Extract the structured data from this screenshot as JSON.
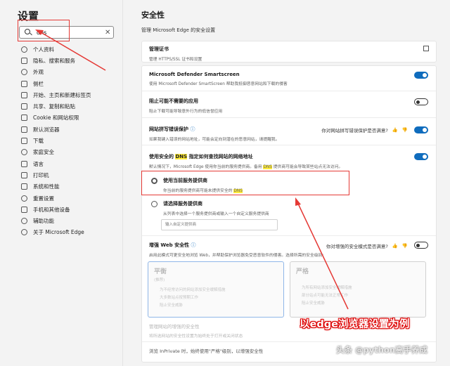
{
  "sidebar": {
    "title": "设置",
    "search_value": "dns",
    "items": [
      {
        "label": "个人资料",
        "icon": "person-icon"
      },
      {
        "label": "隐私、搜索和服务",
        "icon": "lock-icon"
      },
      {
        "label": "外观",
        "icon": "palette-icon"
      },
      {
        "label": "侧栏",
        "icon": "sidebar-icon"
      },
      {
        "label": "开始、主页和新建标签页",
        "icon": "home-icon"
      },
      {
        "label": "共享、复制和粘贴",
        "icon": "share-icon"
      },
      {
        "label": "Cookie 和网站权限",
        "icon": "cookie-icon"
      },
      {
        "label": "默认浏览器",
        "icon": "browser-icon"
      },
      {
        "label": "下载",
        "icon": "download-icon"
      },
      {
        "label": "家庭安全",
        "icon": "family-icon"
      },
      {
        "label": "语言",
        "icon": "language-icon"
      },
      {
        "label": "打印机",
        "icon": "printer-icon"
      },
      {
        "label": "系统和性能",
        "icon": "system-icon"
      },
      {
        "label": "重置设置",
        "icon": "reset-icon"
      },
      {
        "label": "手机和其他设备",
        "icon": "phone-icon"
      },
      {
        "label": "辅助功能",
        "icon": "accessibility-icon"
      },
      {
        "label": "关于 Microsoft Edge",
        "icon": "edge-icon"
      }
    ]
  },
  "main": {
    "title": "安全性",
    "subtitle": "管理 Microsoft Edge 的安全设置",
    "cert": {
      "title": "管理证书",
      "desc": "管理 HTTPS/SSL 证书和设置"
    },
    "smartscreen": {
      "title": "Microsoft Defender Smartscreen",
      "desc": "使用 Microsoft Defender SmartScreen 帮助我抵御恶意网站和下载的侵害",
      "state": "on"
    },
    "pua": {
      "title": "阻止可能不需要的应用",
      "desc": "阻止下载可能导致意外行为的低信誉应用",
      "state": "off"
    },
    "typo": {
      "title": "网站拼写错误保护",
      "desc1": "如果我键入错误的网站地址，可能会定向到潜在的恶意网站，请提醒我。",
      "feedback": "你对网站拼写错误保护是否满意?",
      "state": "on"
    },
    "dns": {
      "title_pre": "使用安全的 ",
      "title_hl": "DNS",
      "title_post": " 指定如何查找网站的网络地址",
      "desc_pre": "默认情况下，Microsoft Edge 使用你当前的服务提供商。备用 ",
      "desc_hl": "DNS",
      "desc_post": " 提供商可能会导致某些站点无法访问。",
      "state": "on",
      "opt1_title": "使用当前服务提供商",
      "opt1_desc_pre": "你当前的服务提供商可能未提供安全的 ",
      "opt1_desc_hl": "DNS",
      "opt2_title": "请选择服务提供商",
      "opt2_desc": "从列表中选择一个服务提供商或输入一个自定义服务提供商",
      "provider_placeholder": "输入自定义提供商"
    },
    "enhanced": {
      "title": "增强 Web 安全性",
      "feedback": "你对增强的安全模式是否满意?",
      "desc": "启用此模式可更安全地浏览 Web，并帮助保护浏览器免受恶意软件的侵害。选择所需的安全级别:",
      "state": "off",
      "balanced": {
        "name": "平衡",
        "sub": "(推荐)",
        "items": [
          "为不经常访问的网站添加安全缓解措施",
          "大多数站点按预期工作",
          "阻止安全威胁"
        ]
      },
      "strict": {
        "name": "严格",
        "items": [
          "为所有网站添加安全缓解措施",
          "部分站点可能无法正常工作",
          "阻止安全威胁"
        ]
      },
      "exceptions_title": "管理网站的增强的安全性",
      "exceptions_desc": "将所选网站的安全性设置为始终处于打开或关闭状态",
      "inprivate": "浏览 InPrivate 时，始终使用\"严格\"级别，以增强安全性"
    }
  },
  "annotation": "以edge浏览器设置为例",
  "watermark": "头条 @python高手养成"
}
